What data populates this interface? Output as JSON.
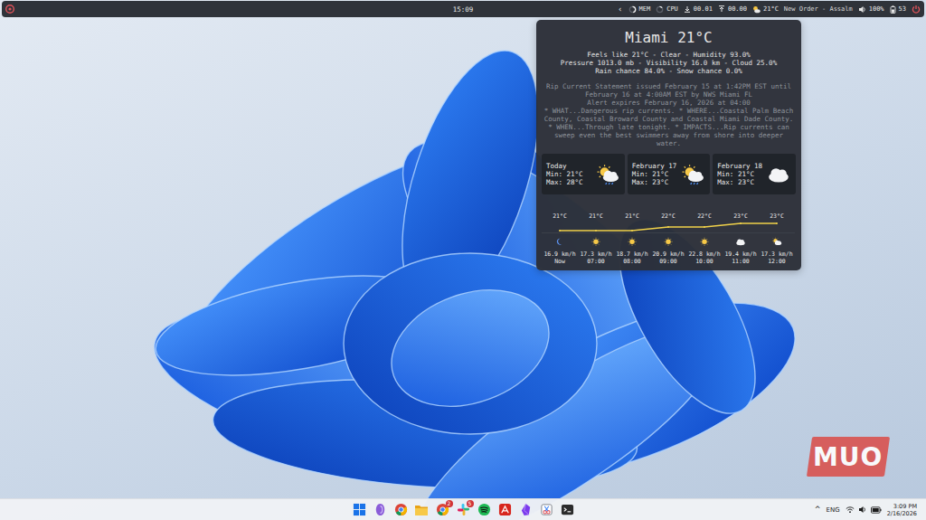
{
  "top_bar": {
    "clock": "15:09",
    "expand": "‹",
    "meters": [
      {
        "label": "MEM",
        "level": 0.45
      },
      {
        "label": "CPU",
        "level": 0.15
      }
    ],
    "download": "00.01",
    "upload": "00.00",
    "weather": "21°C",
    "media": "New Order - Assalm",
    "volume": "100%",
    "battery": "53"
  },
  "weather_popup": {
    "title": "Miami 21°C",
    "details": [
      "Feels like 21°C - Clear - Humidity 93.0%",
      "Pressure 1013.0 mb - Visibility 16.0 km - Cloud 25.0%",
      "Rain chance 84.0% - Snow chance 0.0%"
    ],
    "alert": [
      "Rip Current Statement issued February 15 at 1:42PM EST until February 16 at 4:00AM EST by NWS Miami FL",
      "Alert expires February 16, 2026 at 04:00",
      "* WHAT...Dangerous rip currents. * WHERE...Coastal Palm Beach County, Coastal Broward County and Coastal Miami Dade County. * WHEN...Through late tonight. * IMPACTS...Rip currents can sweep even the best swimmers away from shore into deeper water."
    ],
    "days": [
      {
        "name": "Today",
        "min": "Min: 21°C",
        "max": "Max: 28°C",
        "kind": "showers"
      },
      {
        "name": "February 17",
        "min": "Min: 21°C",
        "max": "Max: 23°C",
        "kind": "showers"
      },
      {
        "name": "February 18",
        "min": "Min: 21°C",
        "max": "Max: 23°C",
        "kind": "cloudy"
      }
    ],
    "hourly": {
      "temps": [
        "21°C",
        "21°C",
        "21°C",
        "22°C",
        "22°C",
        "23°C",
        "23°C"
      ],
      "values": [
        21,
        21,
        21,
        22,
        22,
        23,
        23
      ],
      "hours": [
        {
          "kind": "clear-night",
          "wind": "16.9 km/h",
          "time": "Now"
        },
        {
          "kind": "sunny",
          "wind": "17.3 km/h",
          "time": "07:00"
        },
        {
          "kind": "sunny",
          "wind": "18.7 km/h",
          "time": "08:00"
        },
        {
          "kind": "sunny",
          "wind": "20.9 km/h",
          "time": "09:00"
        },
        {
          "kind": "sunny",
          "wind": "22.8 km/h",
          "time": "10:00"
        },
        {
          "kind": "cloudy",
          "wind": "19.4 km/h",
          "time": "11:00"
        },
        {
          "kind": "partly-cloudy",
          "wind": "17.3 km/h",
          "time": "12:00"
        }
      ]
    }
  },
  "taskbar": {
    "apps": [
      {
        "kind": "start"
      },
      {
        "kind": "copilot"
      },
      {
        "kind": "chrome"
      },
      {
        "kind": "explorer"
      },
      {
        "kind": "chrome-profile",
        "badge": "2"
      },
      {
        "kind": "slack",
        "badge": "5"
      },
      {
        "kind": "spotify"
      },
      {
        "kind": "acrobat"
      },
      {
        "kind": "obsidian"
      },
      {
        "kind": "snipping"
      },
      {
        "kind": "terminal"
      }
    ]
  },
  "tray": {
    "overflow": "^",
    "language": "ENG",
    "time": "3:09 PM",
    "date": "2/16/2026"
  },
  "watermark": "MUO"
}
